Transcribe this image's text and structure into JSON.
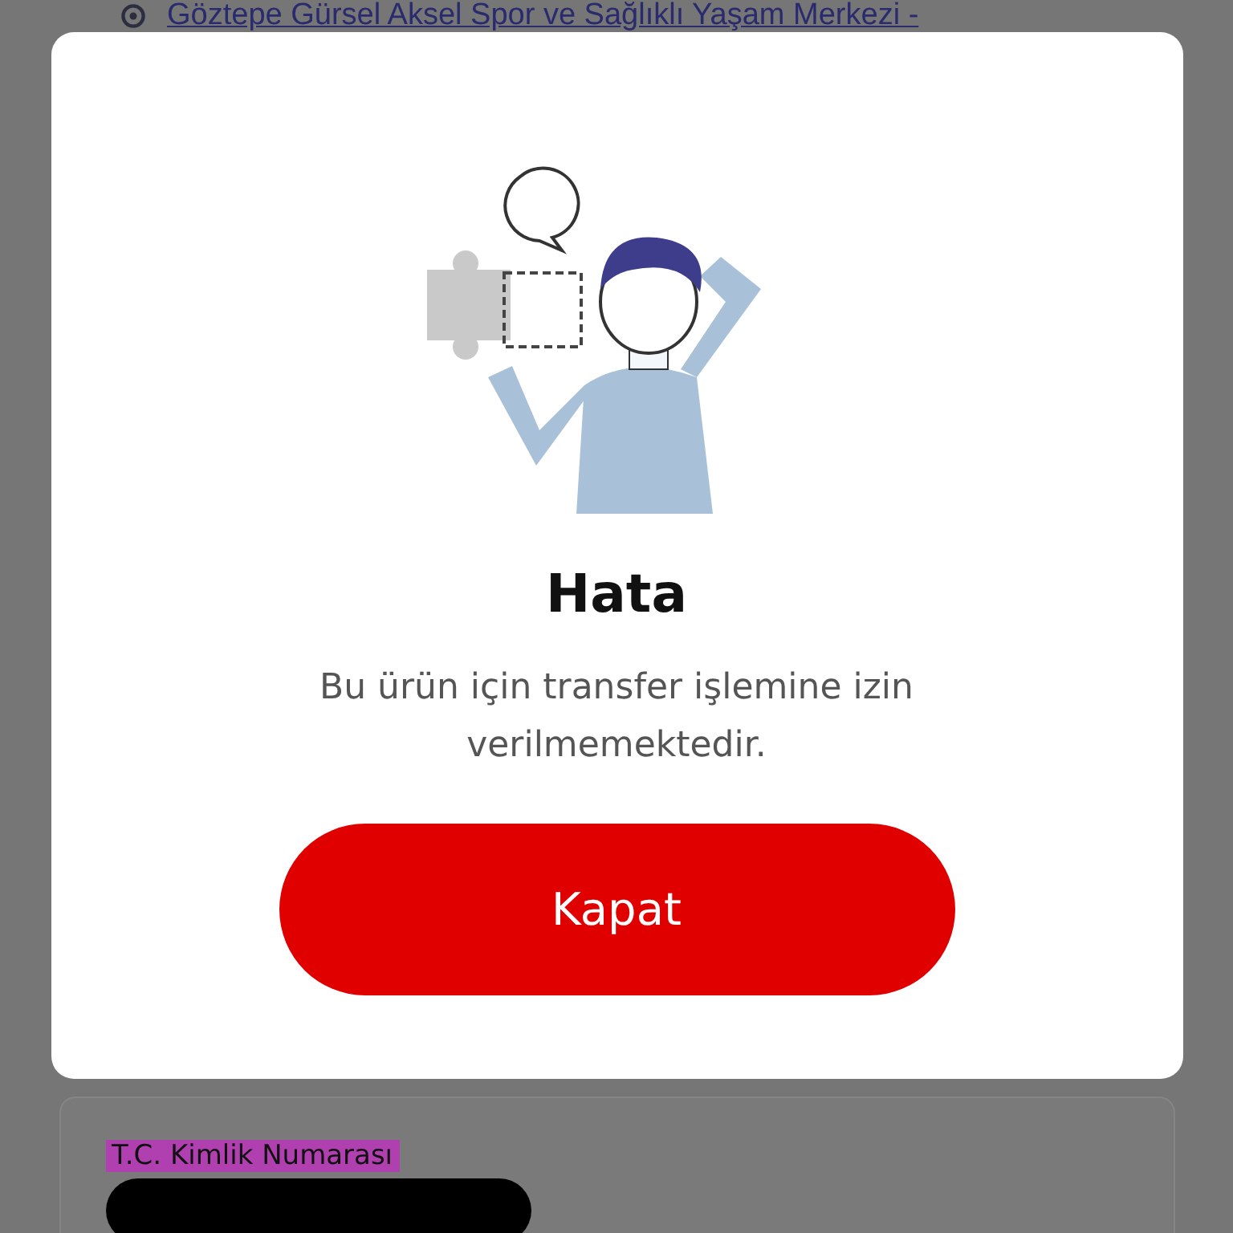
{
  "background": {
    "location_link": "Göztepe Gürsel Aksel Spor ve Sağlıklı Yaşam Merkezi -",
    "field_label": "T.C. Kimlik Numarası"
  },
  "dialog": {
    "title": "Hata",
    "message": "Bu ürün için transfer işlemine izin verilmemektedir.",
    "buttons": [
      {
        "label": "Kapat",
        "kind": "primary"
      }
    ]
  }
}
